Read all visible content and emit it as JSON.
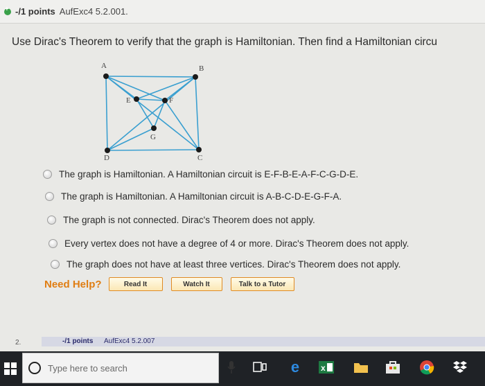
{
  "header": {
    "points_label": "-/1 points",
    "question_id": "AufExc4 5.2.001."
  },
  "question": {
    "text": "Use Dirac's Theorem to verify that the graph is Hamiltonian. Then find a Hamiltonian circu"
  },
  "graph": {
    "vertices": [
      {
        "id": "A",
        "label": "A"
      },
      {
        "id": "B",
        "label": "B"
      },
      {
        "id": "C",
        "label": "C"
      },
      {
        "id": "D",
        "label": "D"
      },
      {
        "id": "E",
        "label": "E"
      },
      {
        "id": "F",
        "label": "F"
      },
      {
        "id": "G",
        "label": "G"
      }
    ]
  },
  "options": [
    "The graph is Hamiltonian. A Hamiltonian circuit is E-F-B-E-A-F-C-G-D-E.",
    "The graph is Hamiltonian. A Hamiltonian circuit is A-B-C-D-E-G-F-A.",
    "The graph is not connected. Dirac's Theorem does not apply.",
    "Every vertex does not have a degree of 4 or more. Dirac's Theorem does not apply.",
    "The graph does not have at least three vertices. Dirac's Theorem does not apply."
  ],
  "help": {
    "label": "Need Help?",
    "read_it": "Read It",
    "watch_it": "Watch It",
    "talk_to_tutor": "Talk to a Tutor"
  },
  "next_question": {
    "number": "2.",
    "points_label": "-/1 points",
    "question_id": "AufExc4 5.2.007"
  },
  "taskbar": {
    "search_placeholder": "Type here to search"
  },
  "colors": {
    "accent_orange": "#e07d12",
    "taskbar_bg": "#1f2226"
  }
}
